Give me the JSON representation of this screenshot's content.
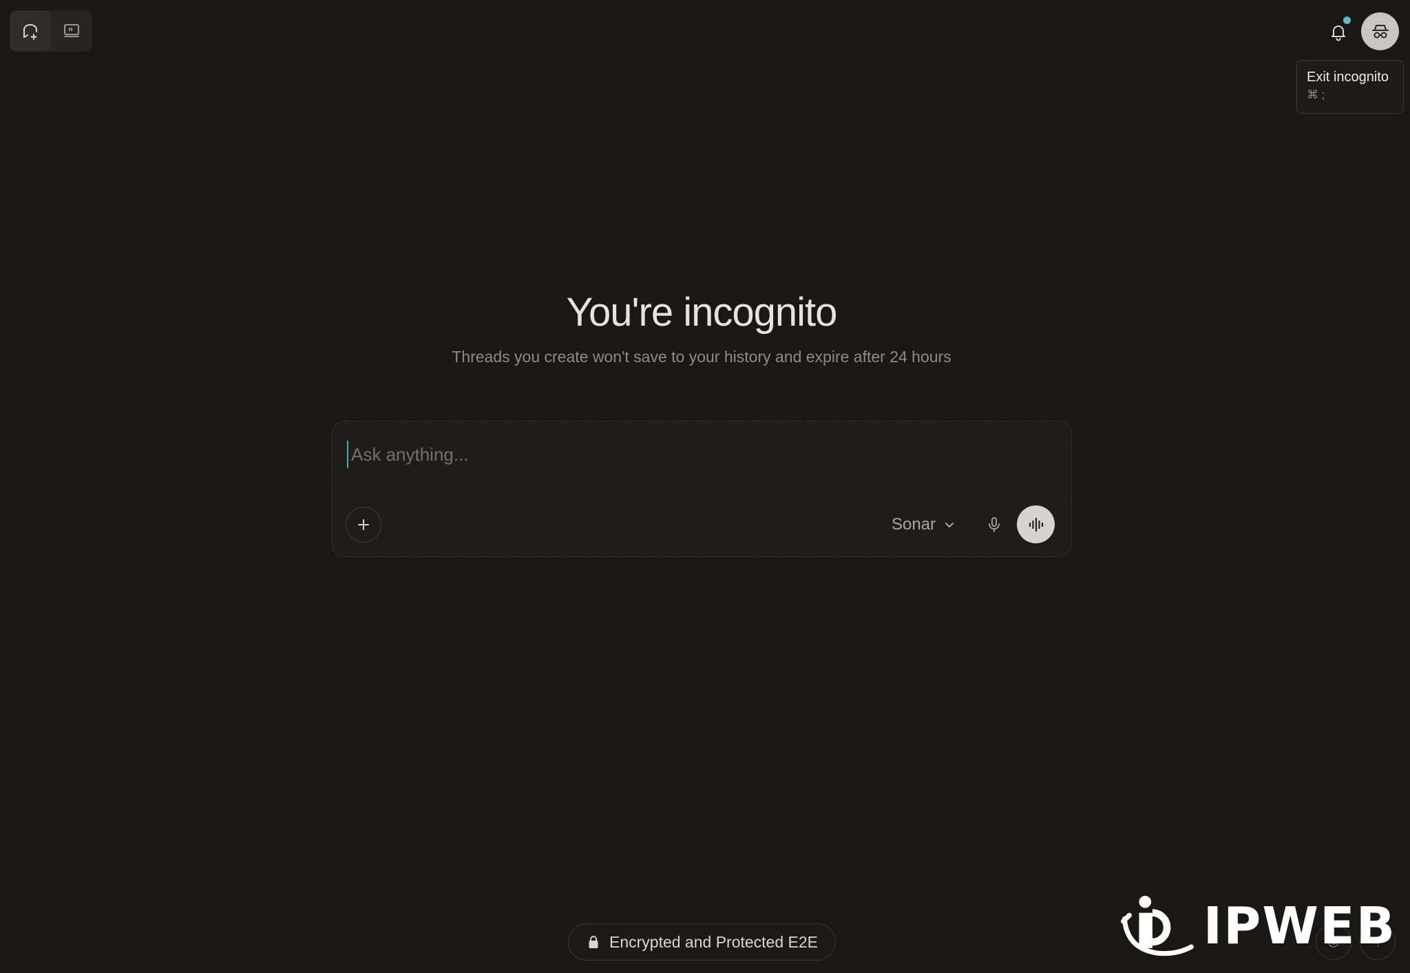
{
  "toolbar": {
    "new_thread_icon": "new-thread-icon",
    "screen_icon": "screen-icon"
  },
  "header": {
    "notification_dot_color": "#5fb8c3",
    "incognito_icon": "incognito-icon"
  },
  "tooltip": {
    "title": "Exit incognito",
    "shortcut": "⌘ ;"
  },
  "hero": {
    "title": "You're incognito",
    "subtitle": "Threads you create won't save to your history and expire after 24 hours"
  },
  "composer": {
    "placeholder": "Ask anything...",
    "value": "",
    "model_label": "Sonar"
  },
  "footer": {
    "security_label": "Encrypted and Protected E2E"
  },
  "watermark": {
    "text": "IPWEB"
  },
  "colors": {
    "background": "#191817",
    "accent": "#5fb8c3"
  }
}
